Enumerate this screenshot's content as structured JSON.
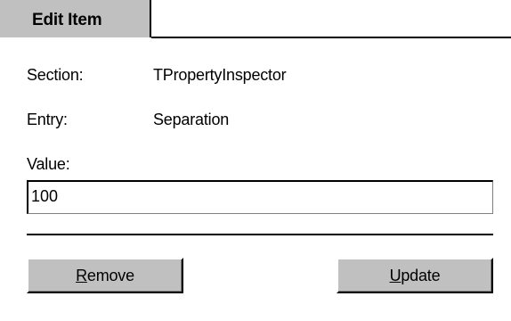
{
  "tab": {
    "label": "Edit Item"
  },
  "form": {
    "section_label": "Section:",
    "section_value": "TPropertyInspector",
    "entry_label": "Entry:",
    "entry_value": "Separation",
    "value_label": "Value:",
    "value": "100"
  },
  "buttons": {
    "remove": {
      "accel": "R",
      "rest": "emove"
    },
    "update": {
      "accel": "U",
      "rest": "pdate"
    }
  },
  "colors": {
    "face": "#c0c0c0",
    "shadow": "#808080",
    "dark": "#000000",
    "highlight": "#ffffff"
  }
}
